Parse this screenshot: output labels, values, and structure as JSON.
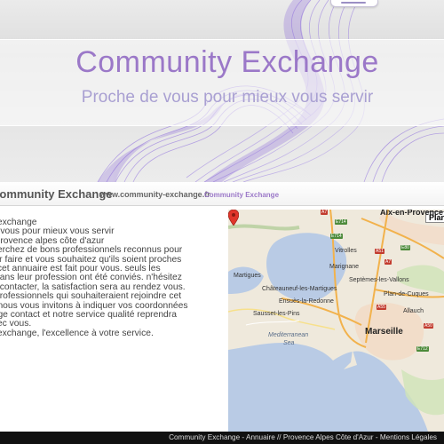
{
  "header": {
    "site_title": "Community Exchange",
    "tagline": "Proche de vous pour mieux vous servir"
  },
  "content_header": {
    "title": "Community Exchange",
    "url": "www.community-exchange.fr",
    "site_name": "Community Exchange"
  },
  "intro": {
    "lines": [
      "ty exchange",
      "de vous pour mieux vous servir",
      "e provence alpes côte d'azur",
      "cherchez de bons professionnels reconnus pour",
      "voir faire et vous souhaitez qu'ils soient proches",
      "s, cet annuaire est fait pour vous. seuls les",
      "s dans leur profession ont été conviés. n'hésitez",
      "es contacter, la satisfaction sera au rendez vous.",
      "s professionnels qui souhaiteraient rejoindre cet",
      "e, nous vous invitons à indiquer vos coordonnées",
      "page contact et notre service qualité reprendra",
      "avec vous.",
      "ty exchange, l'excellence à votre service."
    ]
  },
  "map": {
    "type_button": "Plan",
    "labels": {
      "aix": "Aix-en-Provence",
      "martigues": "Martigues",
      "marignane": "Marignane",
      "vitrolles": "Vitrolles",
      "chateauneuf": "Châteauneuf-les-Martigues",
      "septemes": "Septèmes-les-Vallons",
      "ensues": "Ensuès-la-Redonne",
      "plan_de_cuques": "Plan-de-Cuques",
      "sausset": "Sausset-les-Pins",
      "marseille": "Marseille",
      "allauch": "Allauch",
      "mediterranean": "Mediterranean",
      "sea": "Sea"
    },
    "roads": [
      "A7",
      "E714",
      "A51",
      "A55",
      "A50",
      "E80",
      "A7",
      "E714",
      "E712"
    ]
  },
  "footer": {
    "text": "Community Exchange - Annuaire // Provence Alpes Côte d'Azur - Mentions Légales"
  }
}
